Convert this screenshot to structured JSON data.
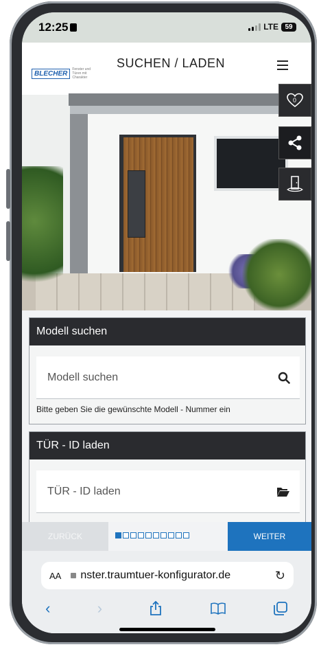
{
  "status": {
    "time": "12:25",
    "network": "LTE",
    "battery": "59"
  },
  "header": {
    "logo_text": "BLECHER",
    "logo_sub": "Fenster und Türen mit Charakter",
    "title": "SUCHEN / LADEN"
  },
  "side_tools": {
    "favorites_count": "0"
  },
  "model_search": {
    "heading": "Modell suchen",
    "placeholder": "Modell suchen",
    "hint": "Bitte geben Sie die gewünschte Modell - Nummer ein"
  },
  "door_id": {
    "heading": "TÜR - ID laden",
    "placeholder": "TÜR - ID laden"
  },
  "pager": {
    "back_label": "ZURÜCK",
    "next_label": "WEITER",
    "total_steps": 10,
    "current_step": 1
  },
  "browser": {
    "aa_label": "AA",
    "url": "nster.traumtuer-konfigurator.de"
  },
  "icons": {
    "heart": "heart-icon",
    "share": "share-icon",
    "door": "door-icon",
    "search": "search-icon",
    "folder": "folder-open-icon",
    "back": "chevron-left-icon",
    "forward": "chevron-right-icon",
    "share_sheet": "share-sheet-icon",
    "bookmarks": "book-icon",
    "tabs": "tabs-icon"
  },
  "colors": {
    "accent": "#1e73be",
    "dark": "#2a2b2f"
  }
}
